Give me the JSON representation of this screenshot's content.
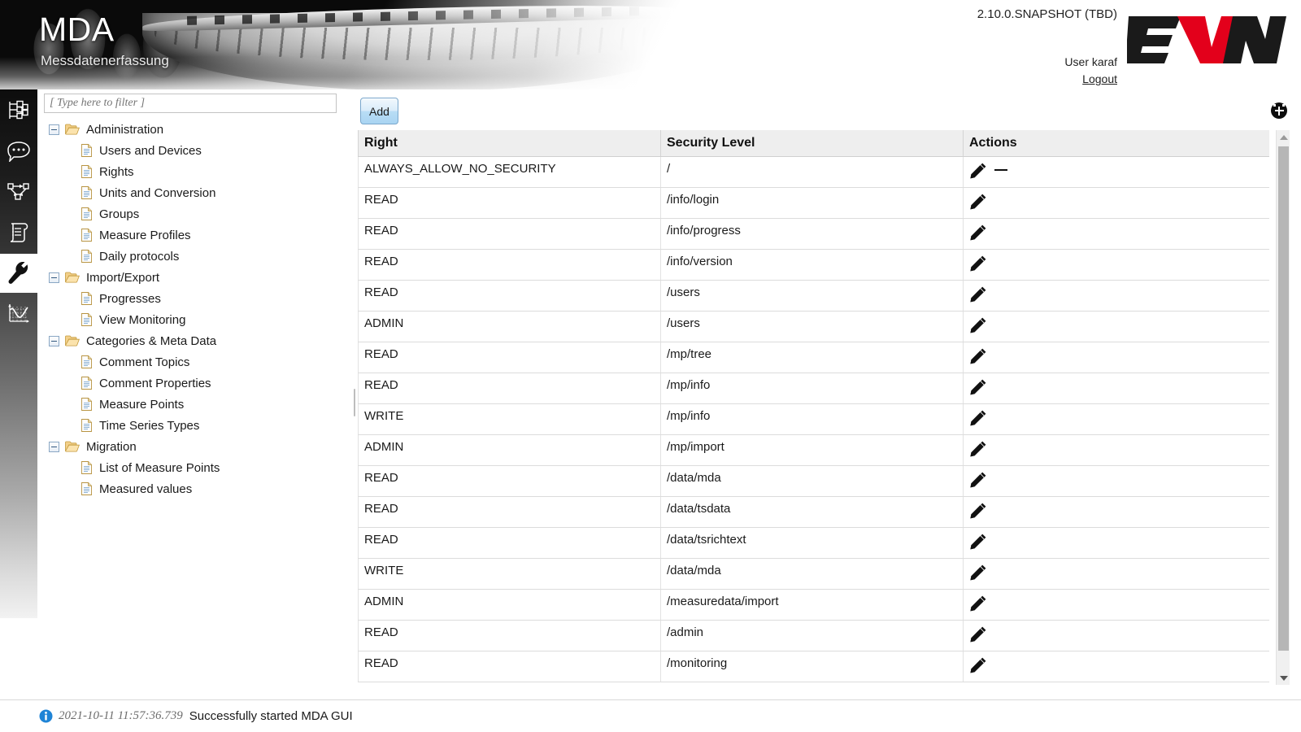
{
  "header": {
    "app_title": "MDA",
    "app_subtitle": "Messdatenerfassung",
    "version": "2.10.0.SNAPSHOT (TBD)",
    "user": "User karaf",
    "logout_label": "Logout",
    "logo_text_1": "E",
    "logo_text_2": "V",
    "logo_text_3": "N",
    "logo_red": "#e3001b",
    "logo_black": "#1a1a1a"
  },
  "icon_rail": {
    "items": [
      {
        "icon": "hierarchy-tree-icon",
        "selected": false
      },
      {
        "icon": "comment-bubble-icon",
        "selected": false
      },
      {
        "icon": "graph-network-icon",
        "selected": false
      },
      {
        "icon": "scroll-protocol-icon",
        "selected": false
      },
      {
        "icon": "wrench-icon",
        "selected": true
      },
      {
        "icon": "chart-curve-icon",
        "selected": false
      }
    ]
  },
  "tree_panel": {
    "filter_placeholder": "[ Type here to filter ]",
    "filter_value": "",
    "nodes": [
      {
        "label": "Administration",
        "type": "folder",
        "expanded": true
      },
      {
        "label": "Users and Devices",
        "type": "leaf"
      },
      {
        "label": "Rights",
        "type": "leaf"
      },
      {
        "label": "Units and Conversion",
        "type": "leaf"
      },
      {
        "label": "Groups",
        "type": "leaf"
      },
      {
        "label": "Measure Profiles",
        "type": "leaf"
      },
      {
        "label": "Daily protocols",
        "type": "leaf"
      },
      {
        "label": "Import/Export",
        "type": "folder",
        "expanded": true
      },
      {
        "label": "Progresses",
        "type": "leaf"
      },
      {
        "label": "View Monitoring",
        "type": "leaf"
      },
      {
        "label": "Categories & Meta Data",
        "type": "folder",
        "expanded": true
      },
      {
        "label": "Comment Topics",
        "type": "leaf"
      },
      {
        "label": "Comment Properties",
        "type": "leaf"
      },
      {
        "label": "Measure Points",
        "type": "leaf"
      },
      {
        "label": "Time Series Types",
        "type": "leaf"
      },
      {
        "label": "Migration",
        "type": "folder",
        "expanded": true
      },
      {
        "label": "List of Measure Points",
        "type": "leaf"
      },
      {
        "label": "Measured values",
        "type": "leaf"
      }
    ]
  },
  "toolbar": {
    "add_label": "Add"
  },
  "table": {
    "columns": [
      "Right",
      "Security Level",
      "Actions"
    ],
    "rows": [
      {
        "right": "ALWAYS_ALLOW_NO_SECURITY",
        "security_level": "/",
        "actions": [
          "edit-icon",
          "remove-icon"
        ]
      },
      {
        "right": "READ",
        "security_level": "/info/login",
        "actions": [
          "edit-icon"
        ]
      },
      {
        "right": "READ",
        "security_level": "/info/progress",
        "actions": [
          "edit-icon"
        ]
      },
      {
        "right": "READ",
        "security_level": "/info/version",
        "actions": [
          "edit-icon"
        ]
      },
      {
        "right": "READ",
        "security_level": "/users",
        "actions": [
          "edit-icon"
        ]
      },
      {
        "right": "ADMIN",
        "security_level": "/users",
        "actions": [
          "edit-icon"
        ]
      },
      {
        "right": "READ",
        "security_level": "/mp/tree",
        "actions": [
          "edit-icon"
        ]
      },
      {
        "right": "READ",
        "security_level": "/mp/info",
        "actions": [
          "edit-icon"
        ]
      },
      {
        "right": "WRITE",
        "security_level": "/mp/info",
        "actions": [
          "edit-icon"
        ]
      },
      {
        "right": "ADMIN",
        "security_level": "/mp/import",
        "actions": [
          "edit-icon"
        ]
      },
      {
        "right": "READ",
        "security_level": "/data/mda",
        "actions": [
          "edit-icon"
        ]
      },
      {
        "right": "READ",
        "security_level": "/data/tsdata",
        "actions": [
          "edit-icon"
        ]
      },
      {
        "right": "READ",
        "security_level": "/data/tsrichtext",
        "actions": [
          "edit-icon"
        ]
      },
      {
        "right": "WRITE",
        "security_level": "/data/mda",
        "actions": [
          "edit-icon"
        ]
      },
      {
        "right": "ADMIN",
        "security_level": "/measuredata/import",
        "actions": [
          "edit-icon"
        ]
      },
      {
        "right": "READ",
        "security_level": "/admin",
        "actions": [
          "edit-icon"
        ]
      },
      {
        "right": "READ",
        "security_level": "/monitoring",
        "actions": [
          "edit-icon"
        ]
      }
    ]
  },
  "status_bar": {
    "icon": "info-icon",
    "timestamp": "2021-10-11 11:57:36.739",
    "message": "Successfully started MDA GUI"
  }
}
